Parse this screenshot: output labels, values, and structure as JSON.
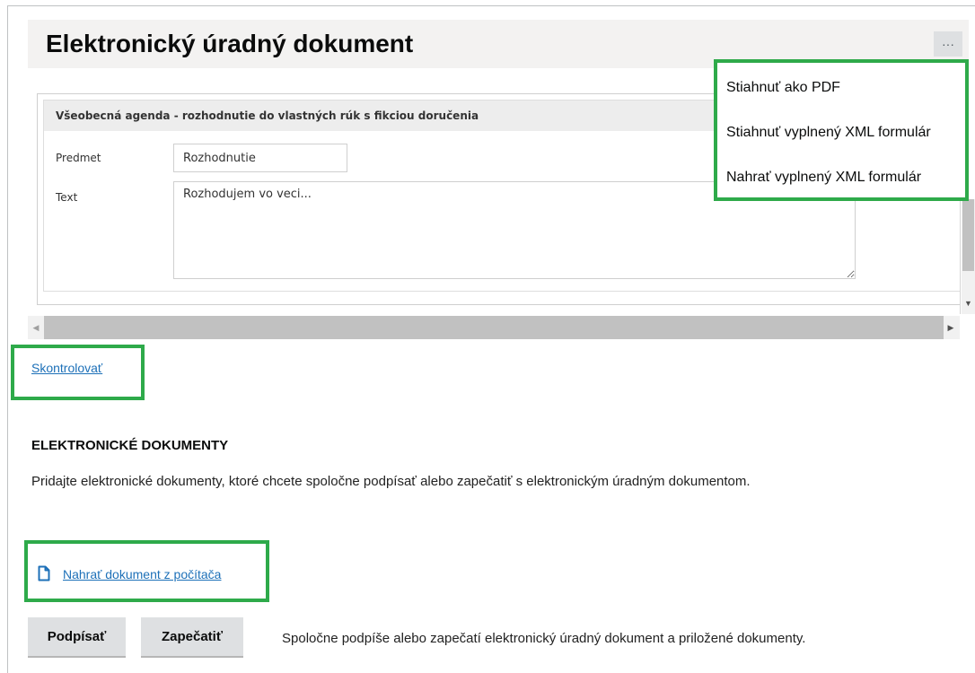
{
  "header": {
    "title": "Elektronický úradný dokument",
    "more_label": "···"
  },
  "menu": {
    "items": [
      {
        "label": "Stiahnuť ako PDF"
      },
      {
        "label": "Stiahnuť vyplnený XML formulár"
      },
      {
        "label": "Nahrať vyplnený XML formulár"
      }
    ]
  },
  "form": {
    "section_title": "Všeobecná agenda - rozhodnutie do vlastných rúk s fikciou doručenia",
    "subject_label": "Predmet",
    "subject_value": "Rozhodnutie",
    "text_label": "Text",
    "text_value": "Rozhodujem vo veci..."
  },
  "check_link": "Skontrolovať",
  "documents": {
    "heading": "ELEKTRONICKÉ DOKUMENTY",
    "description": "Pridajte elektronické dokumenty, ktoré chcete spoločne podpísať alebo zapečatiť s elektronickým úradným dokumentom.",
    "upload_link": "Nahrať dokument z počítača"
  },
  "actions": {
    "sign_label": "Podpísať",
    "seal_label": "Zapečatiť",
    "note": "Spoločne podpíše alebo zapečatí elektronický úradný dokument a priložené dokumenty."
  },
  "colors": {
    "highlight": "#2eaa4a",
    "link": "#1d70b8",
    "header_bg": "#f3f2f1",
    "button_bg": "#dee0e2"
  }
}
